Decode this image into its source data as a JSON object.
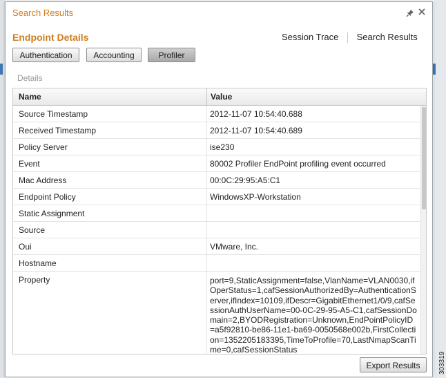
{
  "dialog": {
    "title": "Search Results",
    "section_title": "Endpoint Details",
    "links": [
      "Session Trace",
      "Search Results"
    ],
    "tabs": [
      {
        "label": "Authentication",
        "active": false
      },
      {
        "label": "Accounting",
        "active": false
      },
      {
        "label": "Profiler",
        "active": true
      }
    ],
    "details_label": "Details",
    "table": {
      "columns": [
        "Name",
        "Value"
      ],
      "rows": [
        {
          "name": "Source Timestamp",
          "value": "2012-11-07 10:54:40.688"
        },
        {
          "name": "Received Timestamp",
          "value": "2012-11-07 10:54:40.689"
        },
        {
          "name": "Policy Server",
          "value": "ise230"
        },
        {
          "name": "Event",
          "value": "80002 Profiler EndPoint profiling event occurred"
        },
        {
          "name": "Mac Address",
          "value": "00:0C:29:95:A5:C1"
        },
        {
          "name": "Endpoint Policy",
          "value": "WindowsXP-Workstation"
        },
        {
          "name": "Static Assignment",
          "value": ""
        },
        {
          "name": "Source",
          "value": ""
        },
        {
          "name": "Oui",
          "value": "VMware, Inc."
        },
        {
          "name": "Hostname",
          "value": ""
        },
        {
          "name": "Property",
          "value": "port=9,StaticAssignment=false,VlanName=VLAN0030,ifOperStatus=1,cafSessionAuthorizedBy=AuthenticationServer,ifIndex=10109,ifDescr=GigabitEthernet1/0/9,cafSessionAuthUserName=00-0C-29-95-A5-C1,cafSessionDomain=2,BYODRegistration=Unknown,EndPointPolicyID=a5f92810-be86-11e1-ba69-0050568e002b,FirstCollection=1352205183395,TimeToProfile=70,LastNmapScanTime=0,cafSessionStatus"
        }
      ]
    },
    "export_label": "Export Results"
  },
  "figure_id": "303319",
  "icons": {
    "pin": "pin-icon",
    "close": "close-icon"
  },
  "colors": {
    "accent": "#d07d1f",
    "active_tab": "#b8b8b8"
  }
}
